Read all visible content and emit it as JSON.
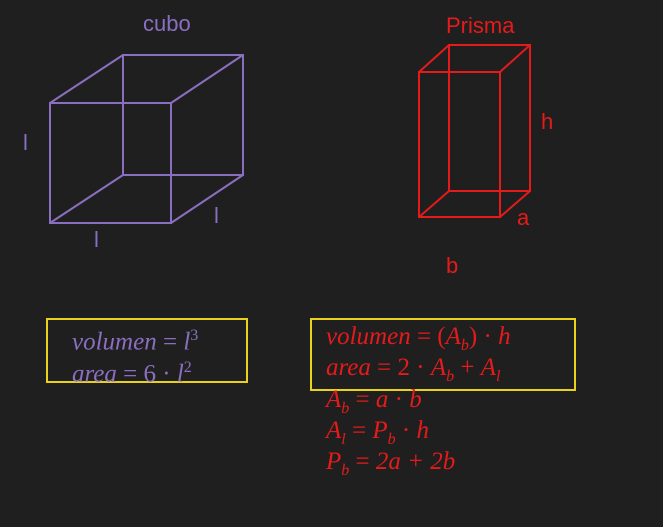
{
  "cube": {
    "title": "cubo",
    "edge_label_left": "l",
    "edge_label_bottom": "l",
    "edge_label_right": "l",
    "color": "#8a6fc0"
  },
  "prism": {
    "title": "Prisma",
    "label_h": "h",
    "label_a": "a",
    "label_b": "b",
    "color": "#e51b1b"
  },
  "cube_formulas": {
    "volume": {
      "lhs": "volumen",
      "rhs_base": "l",
      "rhs_exp": "3"
    },
    "area": {
      "lhs": "area",
      "rhs_coef": "6",
      "rhs_base": "l",
      "rhs_exp": "2"
    }
  },
  "prism_formulas": {
    "volume": {
      "lhs": "volumen",
      "base": "A",
      "sub": "b",
      "factor": "h"
    },
    "area": {
      "lhs": "area",
      "coef": "2",
      "A1": "A",
      "A1_sub": "b",
      "A2": "A",
      "A2_sub": "l"
    },
    "base_area": {
      "lhs": "A",
      "lhs_sub": "b",
      "f1": "a",
      "f2": "b"
    },
    "lateral_area": {
      "lhs": "A",
      "lhs_sub": "l",
      "p": "P",
      "p_sub": "b",
      "factor": "h"
    },
    "perimeter": {
      "lhs": "P",
      "lhs_sub": "b",
      "rhs": "2a + 2b"
    }
  },
  "highlight_color": "#e8d21a"
}
